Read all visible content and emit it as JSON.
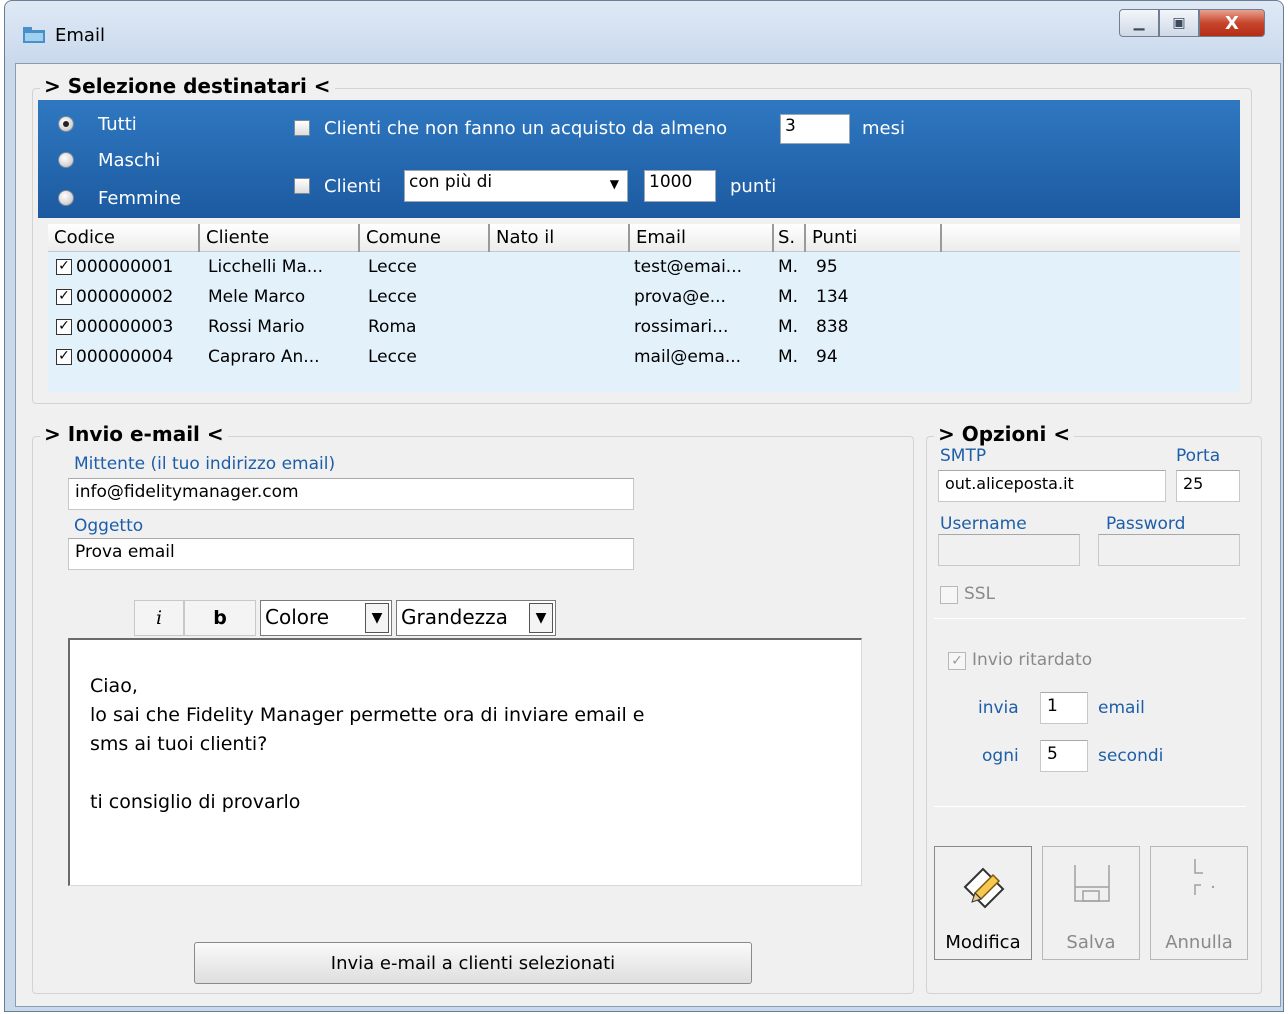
{
  "window": {
    "title": "Email",
    "close_glyph": "X"
  },
  "selezione": {
    "legend": "> Selezione destinatari <",
    "radios": [
      {
        "label": "Tutti",
        "checked": true
      },
      {
        "label": "Maschi",
        "checked": false
      },
      {
        "label": "Femmine",
        "checked": false
      }
    ],
    "filter1": {
      "label": "Clienti che non fanno un acquisto da almeno",
      "value": "3",
      "unit": "mesi"
    },
    "filter2": {
      "label": "Clienti",
      "select": "con più di",
      "value": "1000",
      "unit": "punti"
    }
  },
  "grid": {
    "columns": [
      "Codice",
      "Cliente",
      "Comune",
      "Nato il",
      "Email",
      "S.",
      "Punti"
    ],
    "rows": [
      {
        "codice": "000000001",
        "cliente": "Licchelli Ma...",
        "comune": "Lecce",
        "nato": "",
        "email": "test@emai...",
        "sesso": "M.",
        "punti": "95"
      },
      {
        "codice": "000000002",
        "cliente": "Mele Marco",
        "comune": "Lecce",
        "nato": "",
        "email": "prova@e...",
        "sesso": "M.",
        "punti": "134"
      },
      {
        "codice": "000000003",
        "cliente": "Rossi Mario",
        "comune": "Roma",
        "nato": "",
        "email": "rossimari...",
        "sesso": "M.",
        "punti": "838"
      },
      {
        "codice": "000000004",
        "cliente": "Capraro An...",
        "comune": "Lecce",
        "nato": "",
        "email": "mail@ema...",
        "sesso": "M.",
        "punti": "94"
      }
    ]
  },
  "invio": {
    "legend": "> Invio e-mail <",
    "mittente_label": "Mittente (il tuo indirizzo email)",
    "mittente_value": "info@fidelitymanager.com",
    "oggetto_label": "Oggetto",
    "oggetto_value": "Prova email",
    "toolbar": {
      "italic": "i",
      "bold": "b",
      "colore": "Colore",
      "grandezza": "Grandezza"
    },
    "body": [
      "Ciao,",
      "lo sai che Fidelity Manager permette ora di inviare email e",
      "sms ai tuoi clienti?",
      "",
      "ti consiglio di provarlo"
    ],
    "send_button": "Invia e-mail a clienti selezionati"
  },
  "opzioni": {
    "legend": "> Opzioni <",
    "smtp_label": "SMTP",
    "smtp_value": "out.aliceposta.it",
    "porta_label": "Porta",
    "porta_value": "25",
    "username_label": "Username",
    "password_label": "Password",
    "ssl_label": "SSL",
    "ritardato_label": "Invio ritardato",
    "invia_label": "invia",
    "invia_value": "1",
    "email_label": "email",
    "ogni_label": "ogni",
    "ogni_value": "5",
    "secondi_label": "secondi",
    "buttons": {
      "modifica": "Modifica",
      "salva": "Salva",
      "annulla": "Annulla"
    }
  }
}
